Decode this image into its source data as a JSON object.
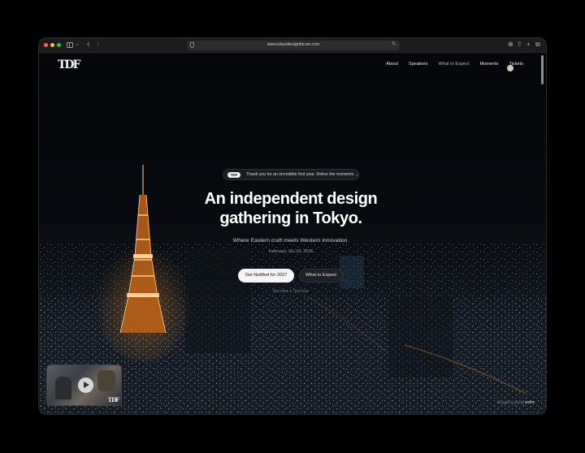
{
  "browser": {
    "url": "www.tokyodesignforum.com"
  },
  "site": {
    "logo": "TDF",
    "nav": [
      {
        "label": "About"
      },
      {
        "label": "Speakers"
      },
      {
        "label": "What to Expect"
      },
      {
        "label": "Moments"
      },
      {
        "label": "Tickets"
      }
    ]
  },
  "hero": {
    "badge": "TDF",
    "announcement": "Thank you for an incredible first year. Relive the moments →",
    "headline_line1": "An independent design",
    "headline_line2": "gathering in Tokyo.",
    "subheading": "Where Eastern craft meets Western innovation.",
    "date": "February 16–18, 2026",
    "primary_cta": "Get Notified for 2027",
    "secondary_cta": "What to Expect",
    "sponsor_link": "Become a Sponsor"
  },
  "video": {
    "logo": "TDF"
  },
  "footer": {
    "credit_prefix": "Brought to you by",
    "credit_brand": "KVOT"
  },
  "colors": {
    "background": "#07090c",
    "tower": "#e08a2a",
    "primary_button": "#f4f4f4",
    "text": "#ffffff"
  }
}
